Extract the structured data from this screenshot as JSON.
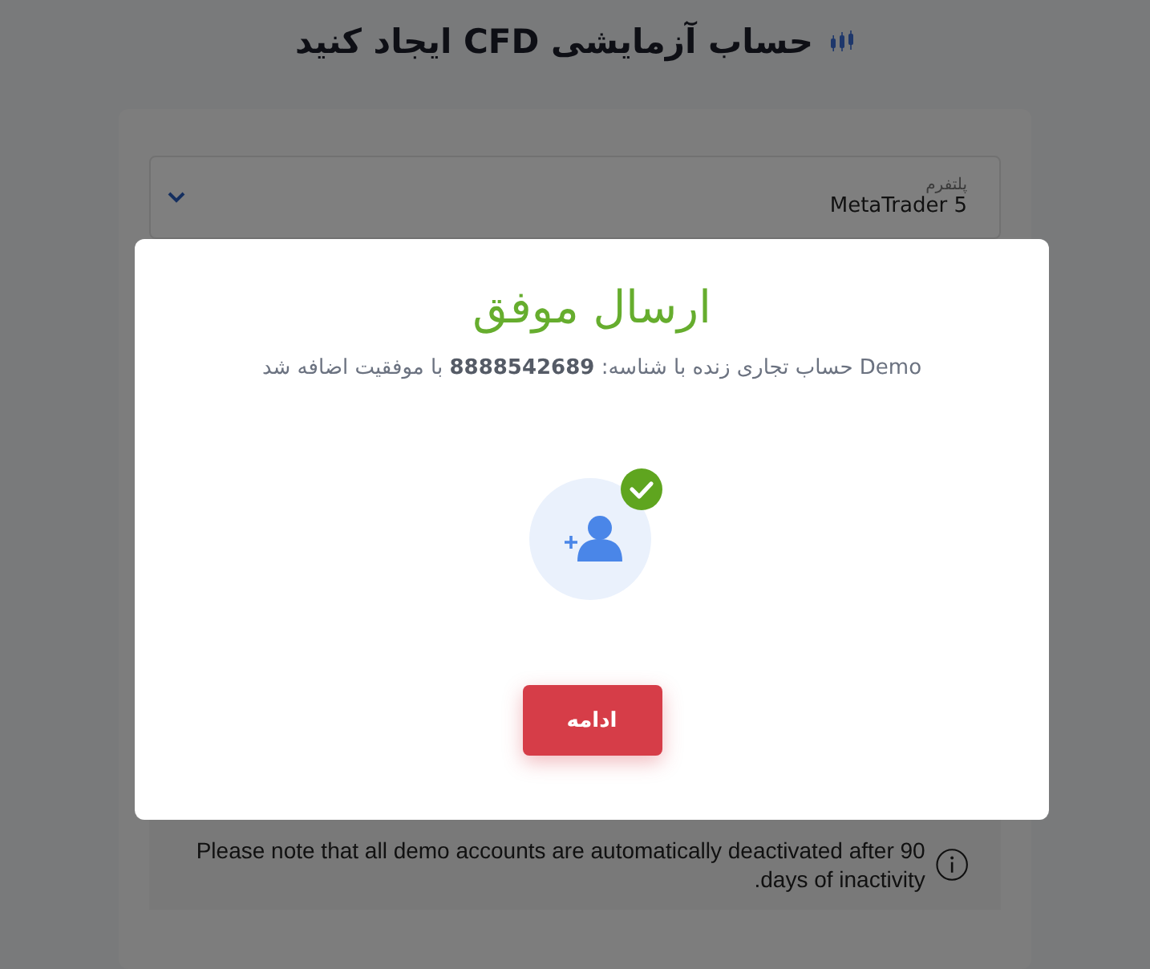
{
  "page": {
    "title": "حساب آزمایشی CFD ایجاد کنید"
  },
  "platform_field": {
    "label": "پلتفرم",
    "value": "MetaTrader 5"
  },
  "notice": {
    "text": "Please note that all demo accounts are automatically deactivated after 90 days of inactivity."
  },
  "dialog": {
    "title": "ارسال موفق",
    "message": "Demo حساب تجاری زنده با شناسه: **8888542689** با موفقیت اضافه شد",
    "button": "ادامه"
  }
}
